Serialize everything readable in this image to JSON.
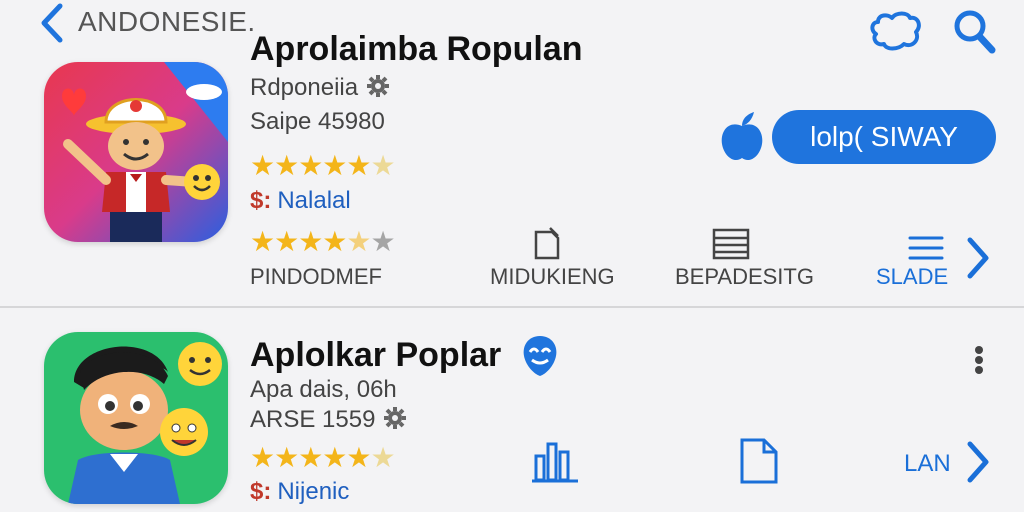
{
  "header": {
    "back_icon": "chevron-left-icon",
    "title": "ANDONESIE.",
    "chat_icon": "chat-bubble-icon",
    "search_icon": "search-icon"
  },
  "colors": {
    "accent": "#1f74dd",
    "star": "#f3b51a",
    "price_symbol": "#c0392b"
  },
  "app1": {
    "title": "Aprolaimba Ropulan",
    "developer": "Rdponeiia",
    "size": "Saipe 45980",
    "rating_stars": 4.5,
    "price_symbol": "$:",
    "price": "Nalalal",
    "secondary_rating_stars": 3.5,
    "get_button": "lolp( SIWAY",
    "actions": {
      "first": "PINDODMEF",
      "second": "MIDUKIENG",
      "third": "BEPADESITG",
      "fourth": "SLADE"
    }
  },
  "app2": {
    "title": "Aplolkar Poplar",
    "developer": "Apa dais, 06h",
    "size": "ARSE 1559",
    "rating_stars": 4.5,
    "price_symbol": "$:",
    "price": "Nijenic",
    "actions": {
      "last": "LAN"
    }
  }
}
